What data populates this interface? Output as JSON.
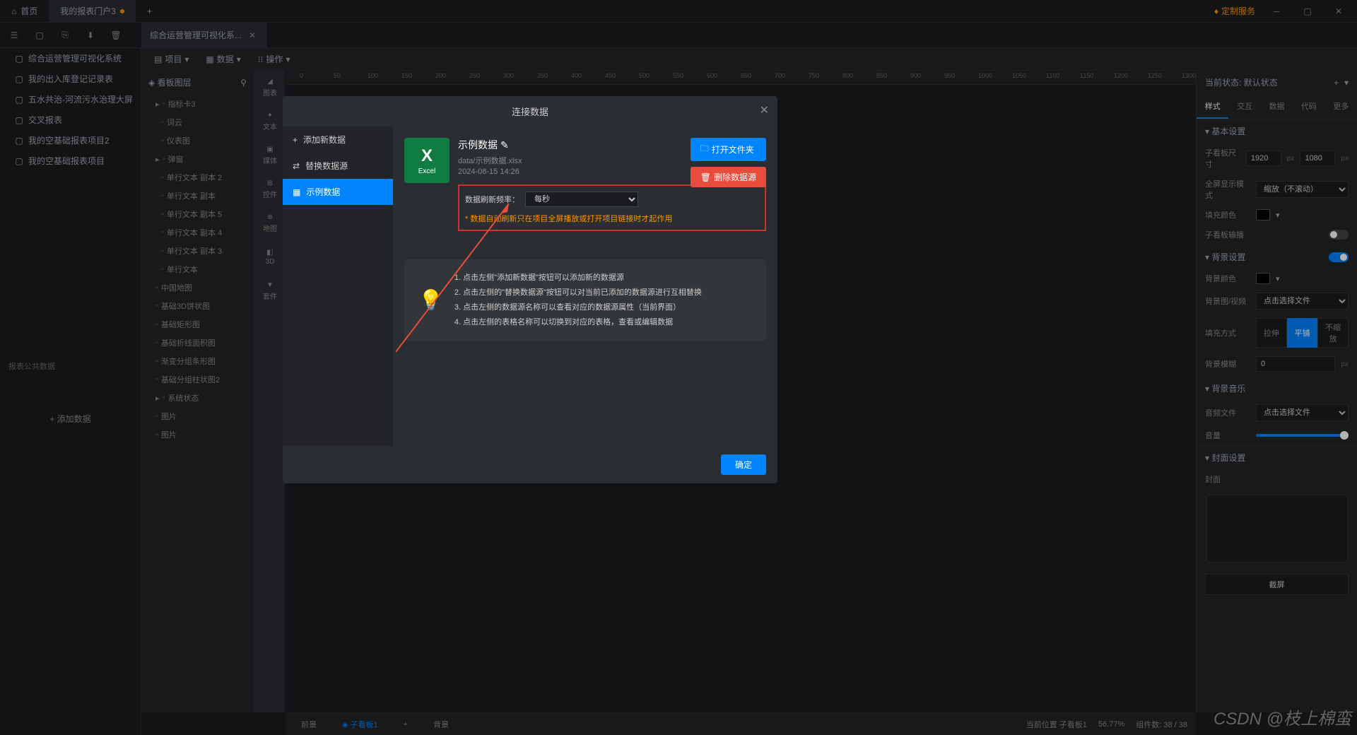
{
  "titlebar": {
    "home": "首页",
    "activeTab": "我的报表门户3",
    "customService": "定制服务"
  },
  "docTab": "综合运营管理可视化系...",
  "leftTree": {
    "items": [
      "综合运营管理可视化系统",
      "我的出入库登记记录表",
      "五水共治-河流污水治理大屏",
      "交叉报表",
      "我的空基础报表项目2",
      "我的空基础报表项目"
    ],
    "publicData": "报表公共数据",
    "addData": "+ 添加数据"
  },
  "menubar": {
    "project": "项目",
    "data": "数据",
    "operation": "操作"
  },
  "layersPanel": {
    "title": "看板图层",
    "items": [
      {
        "label": "指标卡3",
        "indent": 0,
        "expand": true
      },
      {
        "label": "词云",
        "indent": 1
      },
      {
        "label": "仪表图",
        "indent": 1
      },
      {
        "label": "弹窗",
        "indent": 0,
        "expand": true
      },
      {
        "label": "单行文本 副本 2",
        "indent": 1
      },
      {
        "label": "单行文本 副本",
        "indent": 1
      },
      {
        "label": "单行文本 副本 5",
        "indent": 1
      },
      {
        "label": "单行文本 副本 4",
        "indent": 1
      },
      {
        "label": "单行文本 副本 3",
        "indent": 1
      },
      {
        "label": "单行文本",
        "indent": 1
      },
      {
        "label": "中国地图",
        "indent": 0
      },
      {
        "label": "基础3D饼状图",
        "indent": 0
      },
      {
        "label": "基础矩形图",
        "indent": 0
      },
      {
        "label": "基础折线面积图",
        "indent": 0
      },
      {
        "label": "渐变分组条形图",
        "indent": 0
      },
      {
        "label": "基础分组柱状图2",
        "indent": 0
      },
      {
        "label": "系统状态",
        "indent": 0,
        "expand": true
      },
      {
        "label": "图片",
        "indent": 0
      },
      {
        "label": "图片",
        "indent": 0
      }
    ]
  },
  "compToolbar": [
    "图表",
    "文本",
    "媒体",
    "控件",
    "地图",
    "3D",
    "套件"
  ],
  "rulerMarks": [
    "0",
    "50",
    "100",
    "150",
    "200",
    "250",
    "300",
    "350",
    "400",
    "450",
    "500",
    "550",
    "600",
    "650",
    "700",
    "750",
    "800",
    "850",
    "900",
    "950",
    "1000",
    "1050",
    "1100",
    "1150",
    "1200",
    "1250",
    "1300"
  ],
  "rightPanel": {
    "stateLabel": "当前状态:",
    "stateValue": "默认状态",
    "tabs": [
      "样式",
      "交互",
      "数据",
      "代码",
      "更多"
    ],
    "basicSettings": "基本设置",
    "sizeLabel": "子看板尺寸",
    "width": "1920",
    "height": "1080",
    "px": "px",
    "fullscreenLabel": "全屏显示模式",
    "fullscreenValue": "缩放（不滚动）",
    "fillColorLabel": "填充颜色",
    "panelInputLabel": "子看板输播",
    "bgSettings": "背景设置",
    "bgColorLabel": "背景颜色",
    "bgImageLabel": "背景图/视频",
    "bgImagePlaceholder": "点击选择文件",
    "fillModeLabel": "填充方式",
    "fillModes": [
      "拉伸",
      "平铺",
      "不缩放"
    ],
    "bgBlurLabel": "背景模糊",
    "bgBlurValue": "0",
    "bgMusic": "背景音乐",
    "audioLabel": "音频文件",
    "audioPlaceholder": "点击选择文件",
    "volumeLabel": "音量",
    "coverSettings": "封面设置",
    "coverLabel": "封面",
    "screenshotBtn": "截屏"
  },
  "bottomBar": {
    "foreground": "前景",
    "kanban": "子看板1",
    "background": "背景",
    "currentKanban": "当前位置 子看板1",
    "zoom": "56.77%",
    "components": "组件数: 38 / 38"
  },
  "modal": {
    "title": "连接数据",
    "addNew": "添加新数据",
    "replace": "替换数据源",
    "sample": "示例数据",
    "dataTitle": "示例数据",
    "dataPath": "data/示例数据.xlsx",
    "dataTime": "2024-08-15 14:26",
    "excelLabel": "Excel",
    "refreshLabel": "数据刷新频率：",
    "refreshValue": "每秒",
    "refreshNote": "* 数据自动刷新只在项目全屏播放或打开项目链接时才起作用",
    "openFolder": "打开文件夹",
    "deleteSource": "删除数据源",
    "help1": "1. 点击左侧\"添加新数据\"按钮可以添加新的数据源",
    "help2": "2. 点击左侧的\"替换数据源\"按钮可以对当前已添加的数据源进行互相替换",
    "help3": "3. 点击左侧的数据源名称可以查看对应的数据源属性（当前界面）",
    "help4": "4. 点击左侧的表格名称可以切换到对应的表格，查看或编辑数据",
    "confirm": "确定"
  },
  "watermark": "CSDN @枝上棉蛮"
}
